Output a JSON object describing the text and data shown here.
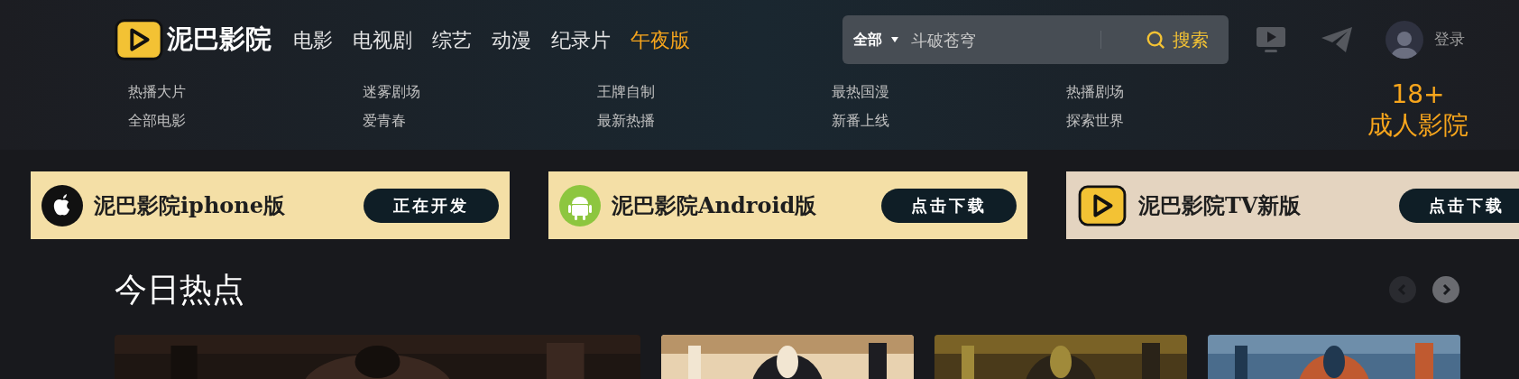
{
  "header": {
    "logo_text": "泥巴影院",
    "nav": [
      {
        "label": "电影",
        "selected": false
      },
      {
        "label": "电视剧",
        "selected": false
      },
      {
        "label": "综艺",
        "selected": false
      },
      {
        "label": "动漫",
        "selected": false
      },
      {
        "label": "纪录片",
        "selected": false
      },
      {
        "label": "午夜版",
        "selected": true
      }
    ],
    "search": {
      "category": "全部",
      "value": "斗破苍穹",
      "button": "搜索"
    },
    "login": "登录"
  },
  "subnav": [
    [
      "热播大片",
      "全部电影"
    ],
    [
      "迷雾剧场",
      "爱青春"
    ],
    [
      "王牌自制",
      "最新热播"
    ],
    [
      "最热国漫",
      "新番上线"
    ],
    [
      "热播剧场",
      "探索世界"
    ]
  ],
  "promo": {
    "line1": "18+",
    "line2": "成人影院"
  },
  "banners": [
    {
      "kind": "apple",
      "title": "泥巴影院iphone版",
      "button": "正在开发"
    },
    {
      "kind": "android",
      "title": "泥巴影院Android版",
      "button": "点击下载"
    },
    {
      "kind": "tv",
      "title": "泥巴影院TV新版",
      "button": "点击下载"
    }
  ],
  "section": {
    "title": "今日热点"
  }
}
